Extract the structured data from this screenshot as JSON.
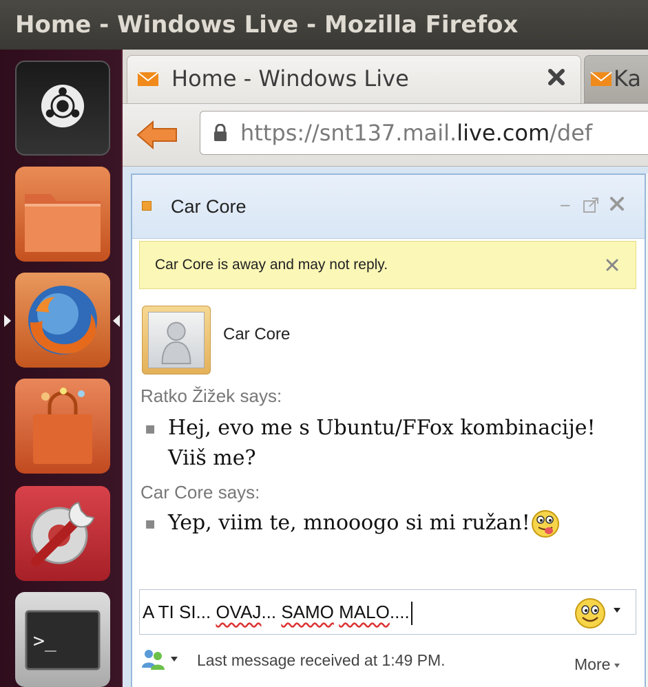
{
  "window": {
    "title": "Home - Windows Live - Mozilla Firefox"
  },
  "launcher": {
    "items": [
      {
        "name": "Ubuntu Dash"
      },
      {
        "name": "Files"
      },
      {
        "name": "Firefox"
      },
      {
        "name": "Ubuntu Software Center"
      },
      {
        "name": "System Settings"
      },
      {
        "name": "Terminal"
      }
    ]
  },
  "browser": {
    "tabs": [
      {
        "label": "Home - Windows Live",
        "active": true
      },
      {
        "label": "Ka",
        "active": false
      }
    ],
    "url": {
      "prefix": "https://snt137.mail.",
      "domain": "live.com",
      "suffix": "/def"
    }
  },
  "chat": {
    "contact": "Car Core",
    "status_color": "#f0a030",
    "away_notice": "Car Core is away and may not reply.",
    "avatar_name": "Car Core",
    "messages": [
      {
        "sender": "Ratko Žižek says:",
        "text": "Hej, evo me s Ubuntu/FFox kombinacije! Viiš me?"
      },
      {
        "sender": "Car Core says:",
        "text": "Yep, viim te, mnooogo si mi ružan!",
        "emoticon": "tongue-out-emoticon"
      }
    ],
    "input": {
      "value_plain_1": "A TI SI... ",
      "value_misspelled_1": "OVAJ",
      "value_plain_2": "... ",
      "value_misspelled_2": "SAMO",
      "value_plain_3": " ",
      "value_misspelled_3": "MALO",
      "value_plain_4": "...."
    },
    "last_message": "Last message received at 1:49 PM.",
    "more_label": "More"
  }
}
